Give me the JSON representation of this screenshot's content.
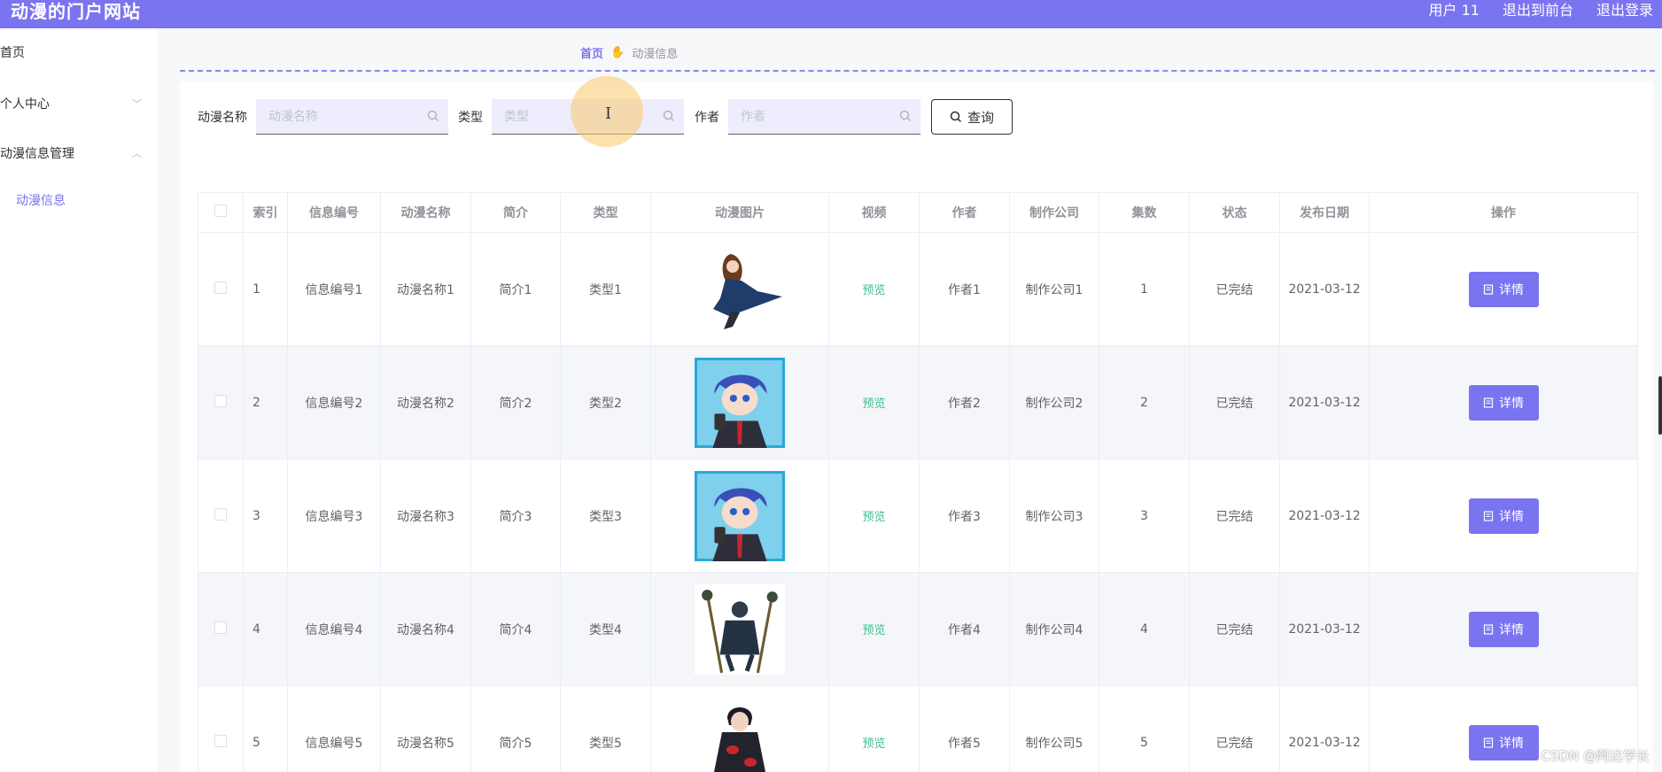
{
  "header": {
    "title": "动漫的门户网站",
    "user": "用户 11",
    "to_front": "退出到前台",
    "logout": "退出登录"
  },
  "sidebar": {
    "items": [
      {
        "label": "首页"
      },
      {
        "label": "个人中心"
      },
      {
        "label": "动漫信息管理"
      }
    ],
    "sub_items": [
      {
        "label": "动漫信息"
      }
    ]
  },
  "breadcrumb": {
    "home": "首页",
    "current": "动漫信息"
  },
  "search": {
    "name_label": "动漫名称",
    "name_placeholder": "动漫名称",
    "type_label": "类型",
    "type_placeholder": "类型",
    "author_label": "作者",
    "author_placeholder": "作者",
    "query_label": "查询"
  },
  "table": {
    "headers": [
      "索引",
      "信息编号",
      "动漫名称",
      "简介",
      "类型",
      "动漫图片",
      "视频",
      "作者",
      "制作公司",
      "集数",
      "状态",
      "发布日期",
      "操作"
    ],
    "rows": [
      {
        "index": "1",
        "code": "信息编号1",
        "name": "动漫名称1",
        "intro": "简介1",
        "type": "类型1",
        "video": "预览",
        "author": "作者1",
        "company": "制作公司1",
        "episodes": "1",
        "status": "已完结",
        "date": "2021-03-12",
        "action": "详情"
      },
      {
        "index": "2",
        "code": "信息编号2",
        "name": "动漫名称2",
        "intro": "简介2",
        "type": "类型2",
        "video": "预览",
        "author": "作者2",
        "company": "制作公司2",
        "episodes": "2",
        "status": "已完结",
        "date": "2021-03-12",
        "action": "详情"
      },
      {
        "index": "3",
        "code": "信息编号3",
        "name": "动漫名称3",
        "intro": "简介3",
        "type": "类型3",
        "video": "预览",
        "author": "作者3",
        "company": "制作公司3",
        "episodes": "3",
        "status": "已完结",
        "date": "2021-03-12",
        "action": "详情"
      },
      {
        "index": "4",
        "code": "信息编号4",
        "name": "动漫名称4",
        "intro": "简介4",
        "type": "类型4",
        "video": "预览",
        "author": "作者4",
        "company": "制作公司4",
        "episodes": "4",
        "status": "已完结",
        "date": "2021-03-12",
        "action": "详情"
      },
      {
        "index": "5",
        "code": "信息编号5",
        "name": "动漫名称5",
        "intro": "简介5",
        "type": "类型5",
        "video": "预览",
        "author": "作者5",
        "company": "制作公司5",
        "episodes": "5",
        "status": "已完结",
        "date": "2021-03-12",
        "action": "详情"
      }
    ]
  },
  "watermark": "CSDN @阿达学长",
  "colors": {
    "accent": "#7b74f0",
    "preview": "#3fbf8f",
    "row_alt": "#f5f6fa"
  }
}
